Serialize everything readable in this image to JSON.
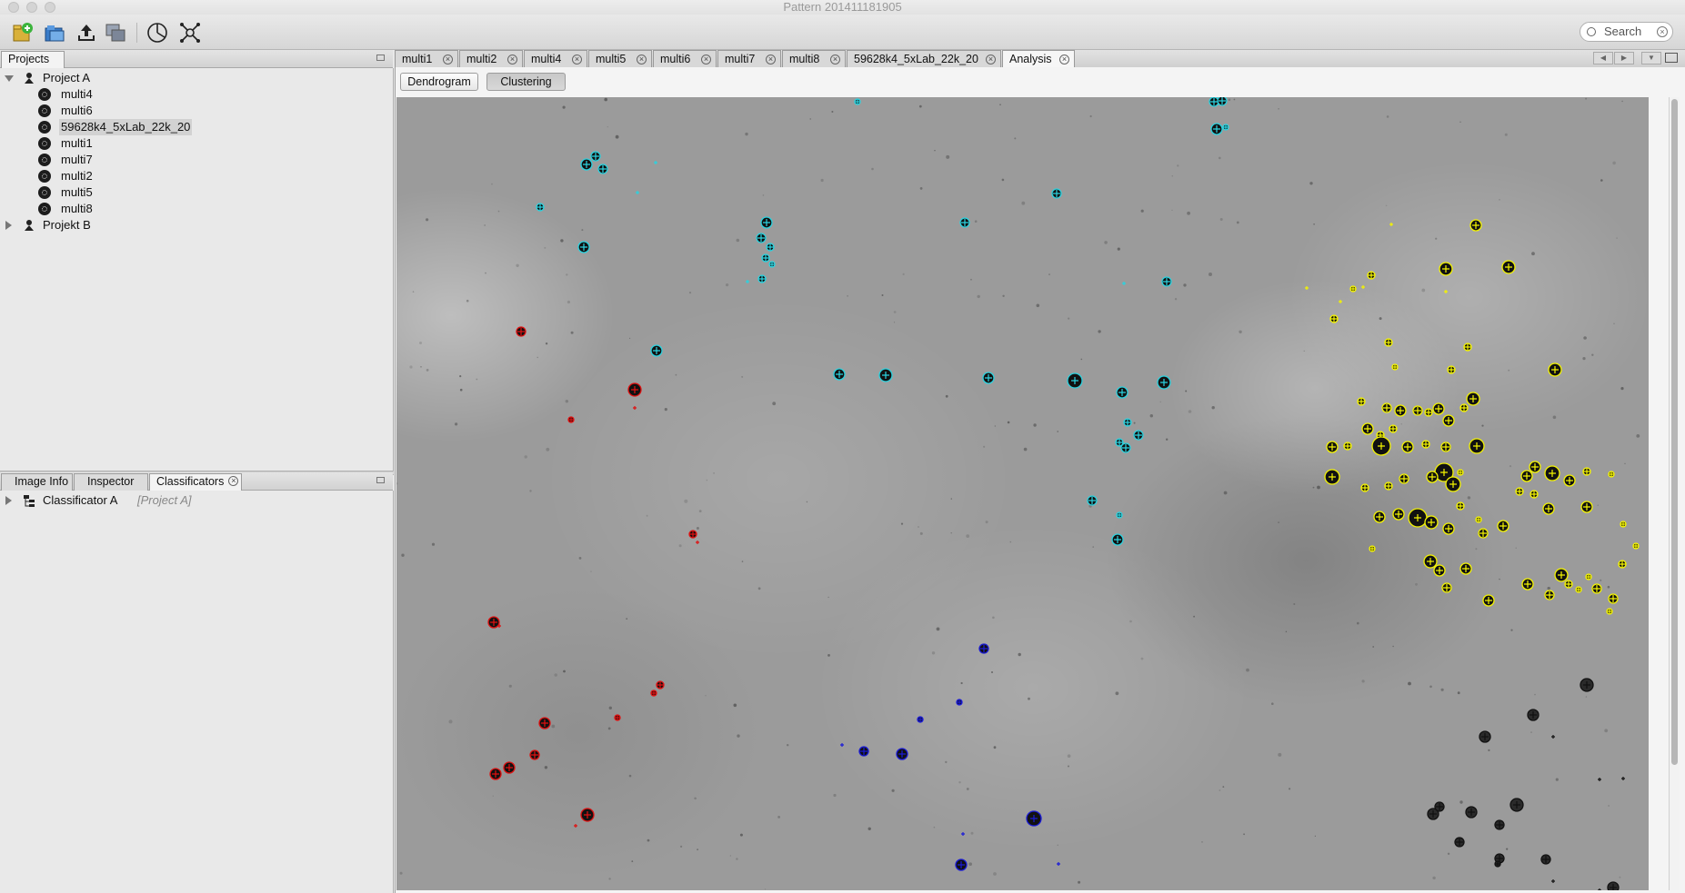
{
  "window": {
    "title": "Pattern 201411181905"
  },
  "toolbar": {
    "buttons": [
      "new-project-icon",
      "open-project-icon",
      "upload-icon",
      "copy-icon",
      "pie-chart-icon",
      "network-icon"
    ],
    "search_placeholder": "Search"
  },
  "projects_panel": {
    "tab_label": "Projects",
    "projects": [
      {
        "label": "Project A",
        "expanded": true,
        "images": [
          "multi4",
          "multi6",
          "59628k4_5xLab_22k_20",
          "multi1",
          "multi7",
          "multi2",
          "multi5",
          "multi8"
        ],
        "selected": "59628k4_5xLab_22k_20"
      },
      {
        "label": "Projekt B",
        "expanded": false
      }
    ]
  },
  "bottom_panel": {
    "tabs": [
      "Image Info",
      "Inspector",
      "Classificators"
    ],
    "active_tab": "Classificators",
    "items": [
      {
        "label": "Classificator A",
        "sublabel": "[Project A]"
      }
    ]
  },
  "editor": {
    "tabs": [
      "multi1",
      "multi2",
      "multi4",
      "multi5",
      "multi6",
      "multi7",
      "multi8",
      "59628k4_5xLab_22k_20",
      "Analysis"
    ],
    "active_tab": "Analysis",
    "subtabs": [
      "Dendrogram",
      "Clustering"
    ],
    "active_subtab": "Clustering"
  },
  "clusters": [
    {
      "name": "cyan",
      "color": "#2ad3e0"
    },
    {
      "name": "yellow",
      "color": "#f4f400"
    },
    {
      "name": "red",
      "color": "#e01010"
    },
    {
      "name": "blue",
      "color": "#1a1ad8"
    },
    {
      "name": "black",
      "color": "#111111"
    }
  ]
}
